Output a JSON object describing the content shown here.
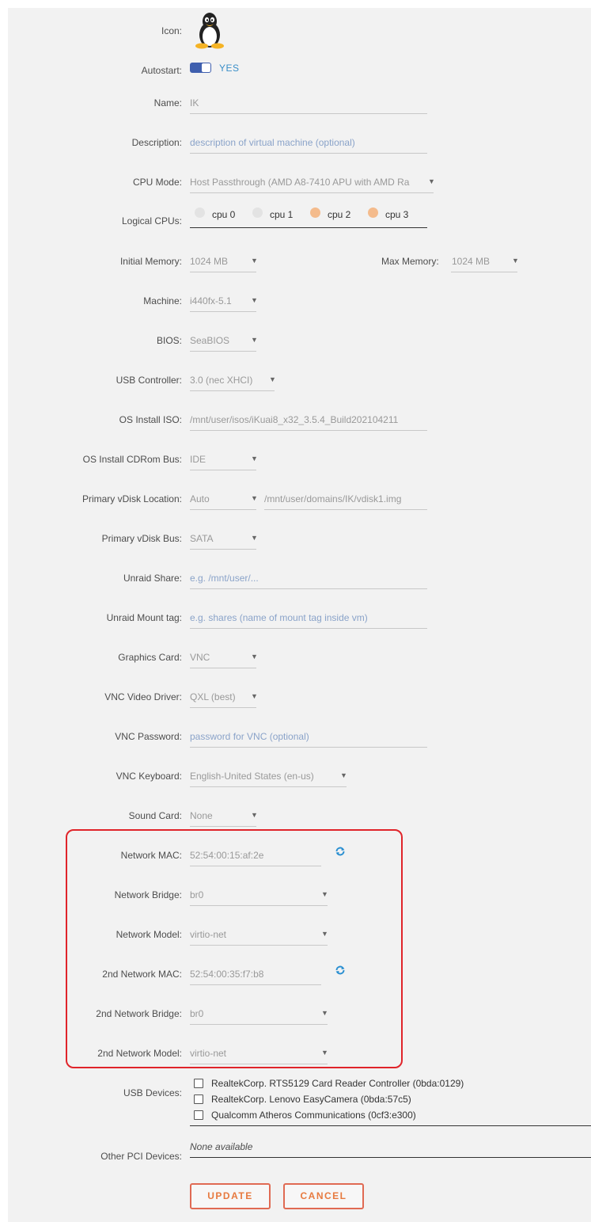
{
  "form": {
    "icon_label": "Icon:",
    "autostart_label": "Autostart:",
    "autostart_value": "YES",
    "name_label": "Name:",
    "name_value": "IK",
    "description_label": "Description:",
    "description_placeholder": "description of virtual machine (optional)",
    "cpu_mode_label": "CPU Mode:",
    "cpu_mode_value": "Host Passthrough (AMD A8-7410 APU with AMD Ra",
    "logical_cpus_label": "Logical CPUs:",
    "cpus": [
      {
        "label": "cpu 0",
        "selected": false
      },
      {
        "label": "cpu 1",
        "selected": false
      },
      {
        "label": "cpu 2",
        "selected": true
      },
      {
        "label": "cpu 3",
        "selected": true
      }
    ],
    "initial_memory_label": "Initial Memory:",
    "initial_memory_value": "1024 MB",
    "max_memory_label": "Max Memory:",
    "max_memory_value": "1024 MB",
    "machine_label": "Machine:",
    "machine_value": "i440fx-5.1",
    "bios_label": "BIOS:",
    "bios_value": "SeaBIOS",
    "usb_controller_label": "USB Controller:",
    "usb_controller_value": "3.0 (nec XHCI)",
    "os_iso_label": "OS Install ISO:",
    "os_iso_value": "/mnt/user/isos/iKuai8_x32_3.5.4_Build202104211",
    "cdrom_bus_label": "OS Install CDRom Bus:",
    "cdrom_bus_value": "IDE",
    "vdisk_location_label": "Primary vDisk Location:",
    "vdisk_location_value": "Auto",
    "vdisk_path_value": "/mnt/user/domains/IK/vdisk1.img",
    "vdisk_bus_label": "Primary vDisk Bus:",
    "vdisk_bus_value": "SATA",
    "unraid_share_label": "Unraid Share:",
    "unraid_share_placeholder": "e.g. /mnt/user/...",
    "mount_tag_label": "Unraid Mount tag:",
    "mount_tag_placeholder": "e.g. shares (name of mount tag inside vm)",
    "graphics_label": "Graphics Card:",
    "graphics_value": "VNC",
    "vnc_driver_label": "VNC Video Driver:",
    "vnc_driver_value": "QXL (best)",
    "vnc_password_label": "VNC Password:",
    "vnc_password_placeholder": "password for VNC (optional)",
    "vnc_keyboard_label": "VNC Keyboard:",
    "vnc_keyboard_value": "English-United States (en-us)",
    "sound_label": "Sound Card:",
    "sound_value": "None",
    "net_mac_label": "Network MAC:",
    "net_mac_value": "52:54:00:15:af:2e",
    "net_bridge_label": "Network Bridge:",
    "net_bridge_value": "br0",
    "net_model_label": "Network Model:",
    "net_model_value": "virtio-net",
    "net2_mac_label": "2nd Network MAC:",
    "net2_mac_value": "52:54:00:35:f7:b8",
    "net2_bridge_label": "2nd Network Bridge:",
    "net2_bridge_value": "br0",
    "net2_model_label": "2nd Network Model:",
    "net2_model_value": "virtio-net",
    "usb_devices_label": "USB Devices:",
    "usb_devices": [
      "RealtekCorp. RTS5129 Card Reader Controller (0bda:0129)",
      "RealtekCorp. Lenovo EasyCamera (0bda:57c5)",
      "Qualcomm Atheros Communications (0cf3:e300)"
    ],
    "pci_label": "Other PCI Devices:",
    "pci_value": "None available",
    "update_label": "UPDATE",
    "cancel_label": "CANCEL"
  },
  "icons": {
    "os_icon": "linux-tux-icon",
    "refresh": "refresh-icon",
    "dropdown": "chevron-down-icon"
  },
  "colors": {
    "accent_orange": "#e77a3f",
    "highlight_red": "#e0242a",
    "toggle_blue": "#3f5fae",
    "cpu_selected": "#f4bb8c"
  }
}
